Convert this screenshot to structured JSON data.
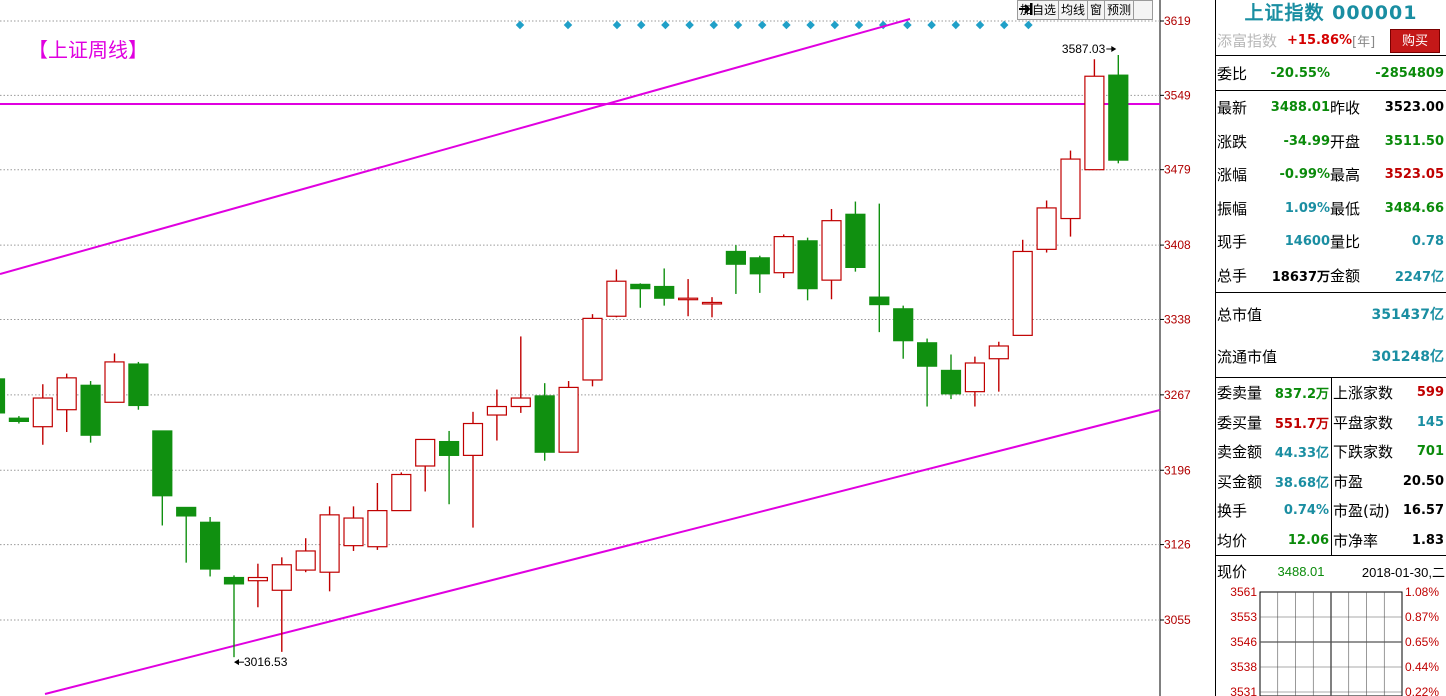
{
  "chart": {
    "title": "【上证周线】",
    "toolbar": [
      "加自选",
      "均线",
      "窗",
      "预测"
    ],
    "toolbar_icon": "exit-arrow-icon",
    "colors": {
      "up": "#c00000",
      "down": "#109010",
      "line": "#e000e0",
      "axis_text": "#b00000",
      "marker": "#20a0c8"
    },
    "price_ticks": [
      "3619",
      "3549",
      "3479",
      "3408",
      "3338",
      "3267",
      "3196",
      "3126",
      "3055"
    ],
    "high_label": "3587.03",
    "low_label": "3016.53",
    "markers": 20
  },
  "chart_data": {
    "type": "candlestick",
    "y_ticks": [
      3619,
      3549,
      3479,
      3408,
      3338,
      3267,
      3196,
      3126,
      3055
    ],
    "ylim": [
      2996,
      3626
    ],
    "candles": [
      {
        "o": 3282,
        "c": 3250,
        "h": 3282,
        "l": 3250
      },
      {
        "o": 3245,
        "c": 3242,
        "h": 3247,
        "l": 3240
      },
      {
        "o": 3237,
        "c": 3264,
        "h": 3277,
        "l": 3220
      },
      {
        "o": 3253,
        "c": 3283,
        "h": 3287,
        "l": 3232
      },
      {
        "o": 3276,
        "c": 3229,
        "h": 3280,
        "l": 3222
      },
      {
        "o": 3260,
        "c": 3298,
        "h": 3306,
        "l": 3260
      },
      {
        "o": 3296,
        "c": 3257,
        "h": 3298,
        "l": 3253
      },
      {
        "o": 3233,
        "c": 3172,
        "h": 3233,
        "l": 3144
      },
      {
        "o": 3161,
        "c": 3153,
        "h": 3161,
        "l": 3109
      },
      {
        "o": 3147,
        "c": 3103,
        "h": 3152,
        "l": 3096
      },
      {
        "o": 3095,
        "c": 3089,
        "h": 3097,
        "l": 3020
      },
      {
        "o": 3092,
        "c": 3095,
        "h": 3108,
        "l": 3067
      },
      {
        "o": 3083,
        "c": 3107,
        "h": 3114,
        "l": 3025
      },
      {
        "o": 3102,
        "c": 3120,
        "h": 3132,
        "l": 3100
      },
      {
        "o": 3100,
        "c": 3154,
        "h": 3162,
        "l": 3082
      },
      {
        "o": 3125,
        "c": 3151,
        "h": 3162,
        "l": 3120
      },
      {
        "o": 3124,
        "c": 3158,
        "h": 3184,
        "l": 3121
      },
      {
        "o": 3158,
        "c": 3192,
        "h": 3194,
        "l": 3158
      },
      {
        "o": 3200,
        "c": 3225,
        "h": 3225,
        "l": 3176
      },
      {
        "o": 3223,
        "c": 3210,
        "h": 3233,
        "l": 3164
      },
      {
        "o": 3210,
        "c": 3240,
        "h": 3251,
        "l": 3142
      },
      {
        "o": 3248,
        "c": 3256,
        "h": 3272,
        "l": 3224
      },
      {
        "o": 3256,
        "c": 3264,
        "h": 3322,
        "l": 3250
      },
      {
        "o": 3266,
        "c": 3213,
        "h": 3278,
        "l": 3205
      },
      {
        "o": 3213,
        "c": 3274,
        "h": 3280,
        "l": 3213
      },
      {
        "o": 3281,
        "c": 3339,
        "h": 3343,
        "l": 3275
      },
      {
        "o": 3341,
        "c": 3374,
        "h": 3385,
        "l": 3340
      },
      {
        "o": 3371,
        "c": 3367,
        "h": 3372,
        "l": 3349
      },
      {
        "o": 3369,
        "c": 3358,
        "h": 3386,
        "l": 3351
      },
      {
        "o": 3358,
        "c": 3358,
        "h": 3376,
        "l": 3341
      },
      {
        "o": 3353,
        "c": 3354,
        "h": 3359,
        "l": 3340
      },
      {
        "o": 3402,
        "c": 3390,
        "h": 3408,
        "l": 3362
      },
      {
        "o": 3396,
        "c": 3381,
        "h": 3398,
        "l": 3363
      },
      {
        "o": 3382,
        "c": 3416,
        "h": 3418,
        "l": 3377
      },
      {
        "o": 3412,
        "c": 3367,
        "h": 3415,
        "l": 3356
      },
      {
        "o": 3375,
        "c": 3431,
        "h": 3442,
        "l": 3357
      },
      {
        "o": 3437,
        "c": 3387,
        "h": 3449,
        "l": 3383
      },
      {
        "o": 3359,
        "c": 3352,
        "h": 3447,
        "l": 3326
      },
      {
        "o": 3348,
        "c": 3318,
        "h": 3351,
        "l": 3301
      },
      {
        "o": 3316,
        "c": 3294,
        "h": 3320,
        "l": 3256
      },
      {
        "o": 3290,
        "c": 3268,
        "h": 3305,
        "l": 3263
      },
      {
        "o": 3270,
        "c": 3297,
        "h": 3303,
        "l": 3256
      },
      {
        "o": 3301,
        "c": 3313,
        "h": 3317,
        "l": 3270
      },
      {
        "o": 3323,
        "c": 3402,
        "h": 3413,
        "l": 3323
      },
      {
        "o": 3404,
        "c": 3443,
        "h": 3450,
        "l": 3401
      },
      {
        "o": 3433,
        "c": 3489,
        "h": 3497,
        "l": 3416
      },
      {
        "o": 3479,
        "c": 3567,
        "h": 3583,
        "l": 3479
      },
      {
        "o": 3568,
        "c": 3488,
        "h": 3587,
        "l": 3485
      }
    ]
  },
  "panel": {
    "title": "上证指数 000001",
    "tiancai_label": "添富指数",
    "tiancai_change": "+15.86%",
    "tiancai_unit": "[年]",
    "buy_label": "购买",
    "weibi_label": "委比",
    "weibi_pct": "-20.55%",
    "weibi_val": "-2854809",
    "quotes": [
      {
        "l1": "最新",
        "n1": "3488.01",
        "c1": "green",
        "l2": "昨收",
        "n2": "3523.00",
        "c2": "black"
      },
      {
        "l1": "涨跌",
        "n1": "-34.99",
        "c1": "green",
        "l2": "开盘",
        "n2": "3511.50",
        "c2": "green"
      },
      {
        "l1": "涨幅",
        "n1": "-0.99%",
        "c1": "green",
        "l2": "最高",
        "n2": "3523.05",
        "c2": "red"
      },
      {
        "l1": "振幅",
        "n1": "1.09%",
        "c1": "teal",
        "l2": "最低",
        "n2": "3484.66",
        "c2": "green"
      },
      {
        "l1": "现手",
        "n1": "14600",
        "c1": "teal",
        "l2": "量比",
        "n2": "0.78",
        "c2": "teal"
      },
      {
        "l1": "总手",
        "n1": "18637万",
        "c1": "black",
        "l2": "金额",
        "n2": "2247亿",
        "c2": "teal"
      }
    ],
    "market_values": [
      {
        "label": "总市值",
        "value": "351437亿"
      },
      {
        "label": "流通市值",
        "value": "301248亿"
      }
    ],
    "left_stats": [
      {
        "label": "委卖量",
        "value": "837.2万",
        "color": "green"
      },
      {
        "label": "委买量",
        "value": "551.7万",
        "color": "red"
      },
      {
        "label": "卖金额",
        "value": "44.33亿",
        "color": "teal"
      },
      {
        "label": "买金额",
        "value": "38.68亿",
        "color": "teal"
      },
      {
        "label": "换手",
        "value": "0.74%",
        "color": "teal"
      },
      {
        "label": "均价",
        "value": "12.06",
        "color": "green"
      }
    ],
    "right_stats": [
      {
        "label": "上涨家数",
        "value": "599",
        "color": "red"
      },
      {
        "label": "平盘家数",
        "value": "145",
        "color": "teal"
      },
      {
        "label": "下跌家数",
        "value": "701",
        "color": "green"
      },
      {
        "label": "市盈",
        "value": "20.50",
        "color": "black"
      },
      {
        "label": "市盈(动)",
        "value": "16.57",
        "color": "black"
      },
      {
        "label": "市净率",
        "value": "1.83",
        "color": "black"
      }
    ],
    "mini": {
      "price_label": "现价",
      "price": "3488.01",
      "date": "2018-01-30,二",
      "left_ticks": [
        "3561",
        "3553",
        "3546",
        "3538",
        "3531"
      ],
      "right_ticks": [
        "1.08%",
        "0.87%",
        "0.65%",
        "0.44%",
        "0.22%"
      ]
    }
  }
}
